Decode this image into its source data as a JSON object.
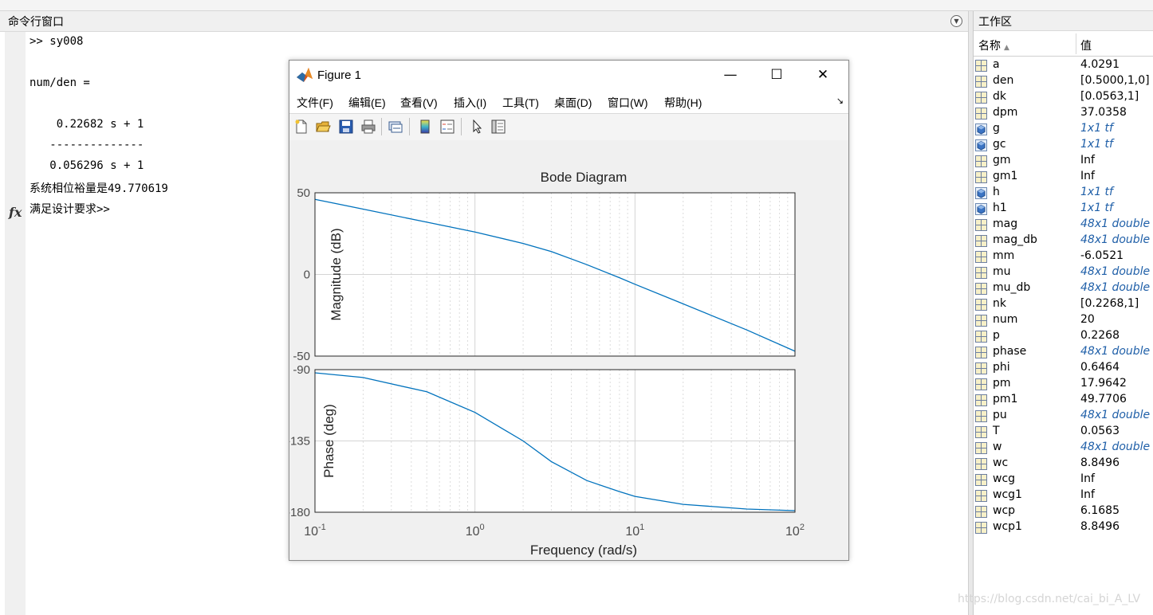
{
  "command_window": {
    "title": "命令行窗口",
    "lines": [
      ">> sy008",
      "num/den =",
      "    0.22682 s + 1",
      "   --------------",
      "   0.056296 s + 1",
      "系统相位裕量是49.770619",
      "满足设计要求>>"
    ],
    "fx_label": "fx"
  },
  "workspace": {
    "title": "工作区",
    "col_name": "名称",
    "col_value": "值",
    "variables": [
      {
        "name": "a",
        "value": "4.0291",
        "kind": "num"
      },
      {
        "name": "den",
        "value": "[0.5000,1,0]",
        "kind": "num"
      },
      {
        "name": "dk",
        "value": "[0.0563,1]",
        "kind": "num"
      },
      {
        "name": "dpm",
        "value": "37.0358",
        "kind": "num"
      },
      {
        "name": "g",
        "value": "1x1 tf",
        "kind": "obj"
      },
      {
        "name": "gc",
        "value": "1x1 tf",
        "kind": "obj"
      },
      {
        "name": "gm",
        "value": "Inf",
        "kind": "num"
      },
      {
        "name": "gm1",
        "value": "Inf",
        "kind": "num"
      },
      {
        "name": "h",
        "value": "1x1 tf",
        "kind": "obj"
      },
      {
        "name": "h1",
        "value": "1x1 tf",
        "kind": "obj"
      },
      {
        "name": "mag",
        "value": "48x1 double",
        "kind": "arr"
      },
      {
        "name": "mag_db",
        "value": "48x1 double",
        "kind": "arr"
      },
      {
        "name": "mm",
        "value": "-6.0521",
        "kind": "num"
      },
      {
        "name": "mu",
        "value": "48x1 double",
        "kind": "arr"
      },
      {
        "name": "mu_db",
        "value": "48x1 double",
        "kind": "arr"
      },
      {
        "name": "nk",
        "value": "[0.2268,1]",
        "kind": "num"
      },
      {
        "name": "num",
        "value": "20",
        "kind": "num"
      },
      {
        "name": "p",
        "value": "0.2268",
        "kind": "num"
      },
      {
        "name": "phase",
        "value": "48x1 double",
        "kind": "arr"
      },
      {
        "name": "phi",
        "value": "0.6464",
        "kind": "num"
      },
      {
        "name": "pm",
        "value": "17.9642",
        "kind": "num"
      },
      {
        "name": "pm1",
        "value": "49.7706",
        "kind": "num"
      },
      {
        "name": "pu",
        "value": "48x1 double",
        "kind": "arr"
      },
      {
        "name": "T",
        "value": "0.0563",
        "kind": "num"
      },
      {
        "name": "w",
        "value": "48x1 double",
        "kind": "arr"
      },
      {
        "name": "wc",
        "value": "8.8496",
        "kind": "num"
      },
      {
        "name": "wcg",
        "value": "Inf",
        "kind": "num"
      },
      {
        "name": "wcg1",
        "value": "Inf",
        "kind": "num"
      },
      {
        "name": "wcp",
        "value": "6.1685",
        "kind": "num"
      },
      {
        "name": "wcp1",
        "value": "8.8496",
        "kind": "num"
      }
    ]
  },
  "figure": {
    "title": "Figure 1",
    "menu": [
      "文件(F)",
      "编辑(E)",
      "查看(V)",
      "插入(I)",
      "工具(T)",
      "桌面(D)",
      "窗口(W)",
      "帮助(H)"
    ],
    "toolbar_icons": [
      "new-figure-icon",
      "open-icon",
      "save-icon",
      "print-icon",
      "link-icon",
      "colorbar-icon",
      "legend-icon",
      "pointer-icon",
      "property-inspector-icon"
    ]
  },
  "watermark": "https://blog.csdn.net/cai_bi_A_LV",
  "colors": {
    "curve": "#0072bd",
    "obj_value": "#1f5fa8"
  },
  "chart_data": {
    "type": "line",
    "title": "Bode Diagram",
    "xlabel": "Frequency  (rad/s)",
    "xscale": "log",
    "xlim": [
      0.1,
      100
    ],
    "x_tick_labels": [
      "10^-1",
      "10^0",
      "10^1",
      "10^2"
    ],
    "grid": true,
    "panels": [
      {
        "ylabel": "Magnitude (dB)",
        "ylim": [
          -50,
          50
        ],
        "y_ticks": [
          50,
          0,
          -50
        ],
        "series": [
          {
            "x": [
              0.1,
              0.2,
              0.5,
              1,
              2,
              3,
              5,
              8,
              10,
              20,
              50,
              100
            ],
            "values": [
              46.0,
              40.0,
              32.0,
              26.0,
              19.0,
              14.0,
              6.0,
              -2.0,
              -6.0,
              -18.0,
              -34.0,
              -47.0
            ]
          }
        ]
      },
      {
        "ylabel": "Phase (deg)",
        "ylim": [
          -180,
          -90
        ],
        "y_ticks": [
          -90,
          -135,
          -180
        ],
        "series": [
          {
            "x": [
              0.1,
              0.2,
              0.5,
              1,
              2,
              3,
              5,
              8,
              10,
              20,
              50,
              100
            ],
            "values": [
              -92.0,
              -95.0,
              -104.0,
              -117.0,
              -135.0,
              -148.0,
              -160.0,
              -167.0,
              -170.0,
              -175.0,
              -178.0,
              -179.0
            ]
          }
        ]
      }
    ]
  }
}
